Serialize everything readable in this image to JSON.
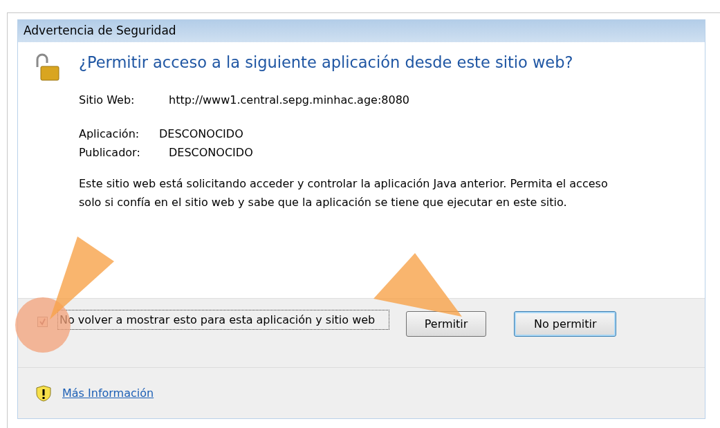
{
  "window": {
    "title": "Advertencia de Seguridad"
  },
  "heading": "¿Permitir acceso a la siguiente aplicación desde este sitio web?",
  "details": [
    {
      "label": "Sitio Web:",
      "value": "http://www1.central.sepg.minhac.age:8080"
    },
    {
      "label": "Aplicación:",
      "value": "DESCONOCIDO"
    },
    {
      "label": "Publicador:",
      "value": "DESCONOCIDO"
    }
  ],
  "description": "Este sitio web está solicitando acceder y controlar la aplicación Java anterior. Permita el acceso solo si confía en el sitio web y sabe que la aplicación se tiene que ejecutar en este sitio.",
  "checkbox": {
    "label": "No volver a mostrar esto para esta aplicación y sitio web",
    "checked": true
  },
  "buttons": [
    {
      "label": "Permitir",
      "default": false
    },
    {
      "label": "No permitir",
      "default": true
    }
  ],
  "link": "Más Información",
  "annotations": [
    {
      "kind": "highlight"
    },
    {
      "kind": "arrow"
    },
    {
      "kind": "arrow"
    }
  ]
}
